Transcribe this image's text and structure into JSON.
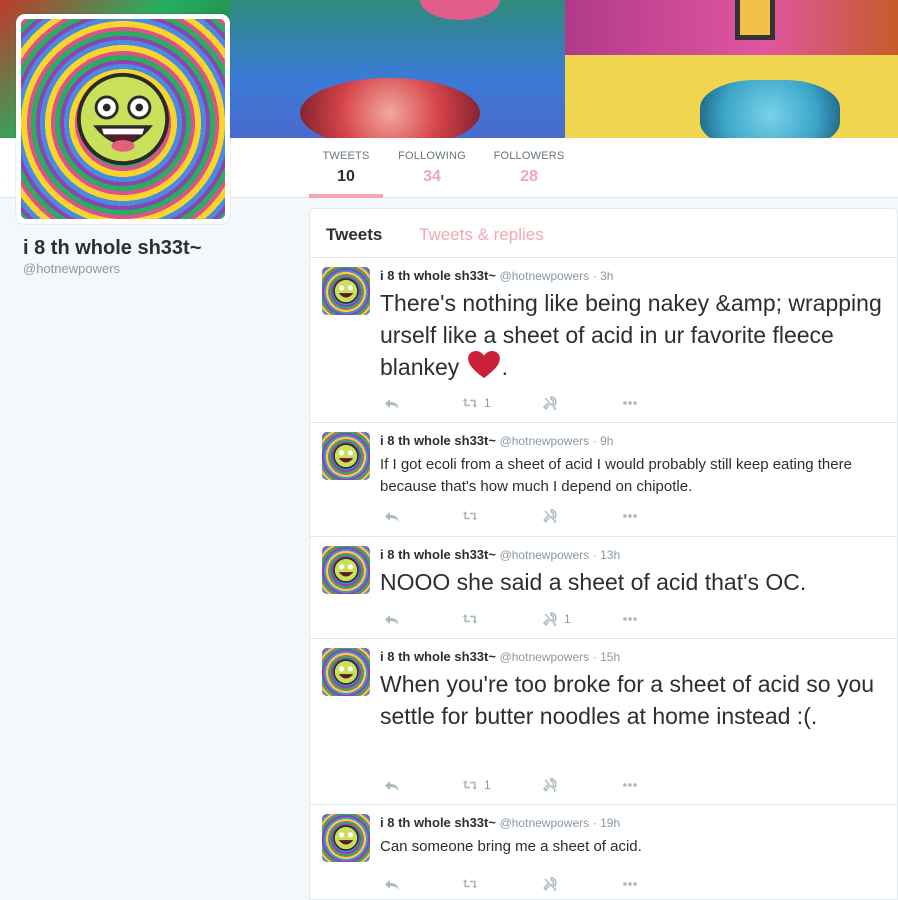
{
  "profile": {
    "name": "i 8 th whole sh33t~",
    "handle": "@hotnewpowers"
  },
  "stats": [
    {
      "label": "TWEETS",
      "value": "10"
    },
    {
      "label": "FOLLOWING",
      "value": "34"
    },
    {
      "label": "FOLLOWERS",
      "value": "28"
    }
  ],
  "tabs": {
    "tweets": "Tweets",
    "replies": "Tweets & replies"
  },
  "colors": {
    "accent": "#f4a6b4",
    "heart": "#cc1f3a"
  },
  "tweets": [
    {
      "name": "i 8 th whole sh33t~",
      "handle": "@hotnewpowers",
      "time": "· 3h",
      "text": "There's nothing like being nakey &amp; wrapping urself like a sheet of acid in ur favorite fleece blankey",
      "text_suffix": ".",
      "emoji": "red-heart",
      "retweets": "1",
      "favorites": ""
    },
    {
      "name": "i 8 th whole sh33t~",
      "handle": "@hotnewpowers",
      "time": "· 9h",
      "text": "If I got ecoli from a sheet of acid I would probably still keep eating there because that's how much I depend on chipotle.",
      "retweets": "",
      "favorites": ""
    },
    {
      "name": "i 8 th whole sh33t~",
      "handle": "@hotnewpowers",
      "time": "· 13h",
      "text": "NOOO she said a sheet of acid that's OC.",
      "retweets": "",
      "favorites": "1"
    },
    {
      "name": "i 8 th whole sh33t~",
      "handle": "@hotnewpowers",
      "time": "· 15h",
      "text": "When you're too broke for a sheet of acid so you settle for butter noodles at home instead :(.",
      "retweets": "1",
      "favorites": ""
    },
    {
      "name": "i 8 th whole sh33t~",
      "handle": "@hotnewpowers",
      "time": "· 19h",
      "text": "Can someone bring me a sheet of acid.",
      "retweets": "",
      "favorites": ""
    }
  ]
}
